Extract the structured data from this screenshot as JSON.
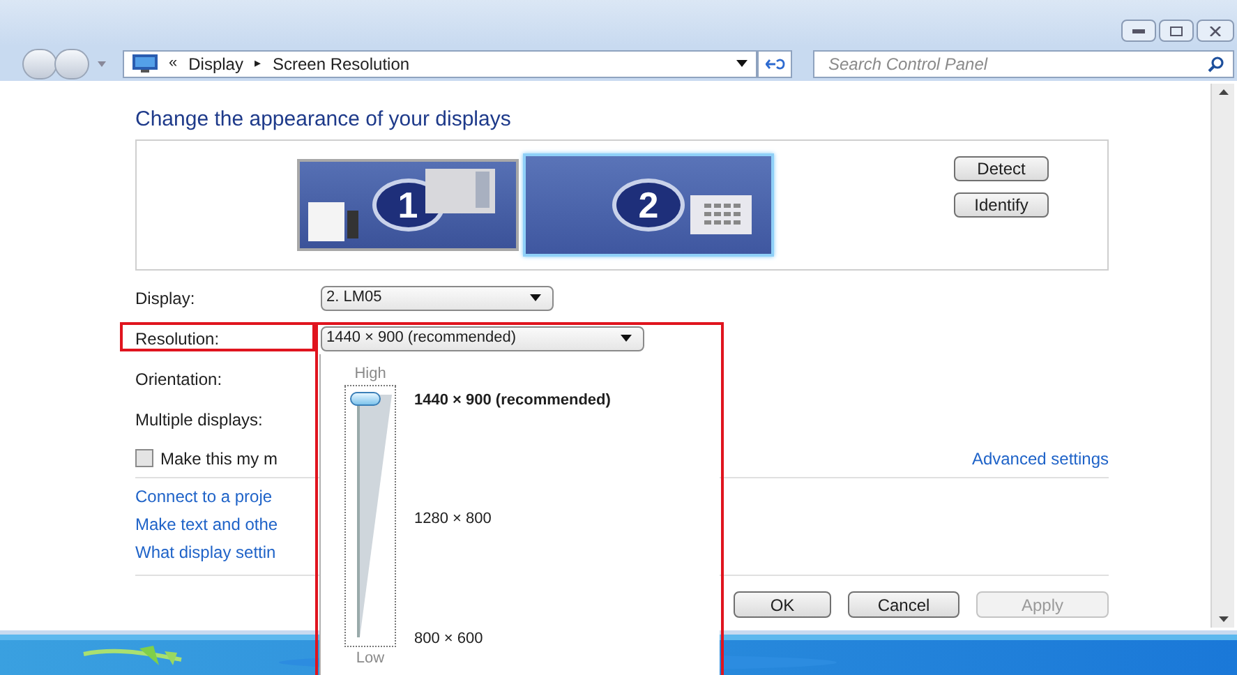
{
  "address_bar": {
    "prefix": "«",
    "crumbs": [
      "Display",
      "Screen Resolution"
    ],
    "separator": "▸"
  },
  "search": {
    "placeholder": "Search Control Panel"
  },
  "heading": "Change the appearance of your displays",
  "monitors": [
    {
      "label": "1",
      "selected": false
    },
    {
      "label": "2",
      "selected": true
    }
  ],
  "monitor_buttons": [
    "Detect",
    "Identify"
  ],
  "fields": [
    {
      "label": "Display:",
      "value": "2. LM05",
      "highlighted": false
    },
    {
      "label": "Resolution:",
      "value": "1440 × 900 (recommended)",
      "highlighted": true
    },
    {
      "label": "Orientation:",
      "highlighted": false
    },
    {
      "label": "Multiple displays:",
      "highlighted": false
    }
  ],
  "primary_checkbox": {
    "label": "Make this my m",
    "checked": false
  },
  "advanced_link": "Advanced settings",
  "links": [
    "Connect to a proje",
    "Make text and othe",
    "What display settin"
  ],
  "resolution_popup": {
    "highlighted": true,
    "high_label": "High",
    "low_label": "Low",
    "level": 1,
    "options": [
      {
        "label": "1440 × 900 (recommended)",
        "selected": true
      },
      {
        "label": "1280 × 800",
        "selected": false
      },
      {
        "label": "800 × 600",
        "selected": false
      }
    ]
  },
  "buttons": [
    {
      "label": "OK",
      "disabled": false
    },
    {
      "label": "Cancel",
      "disabled": false
    },
    {
      "label": "Apply",
      "disabled": true
    }
  ]
}
